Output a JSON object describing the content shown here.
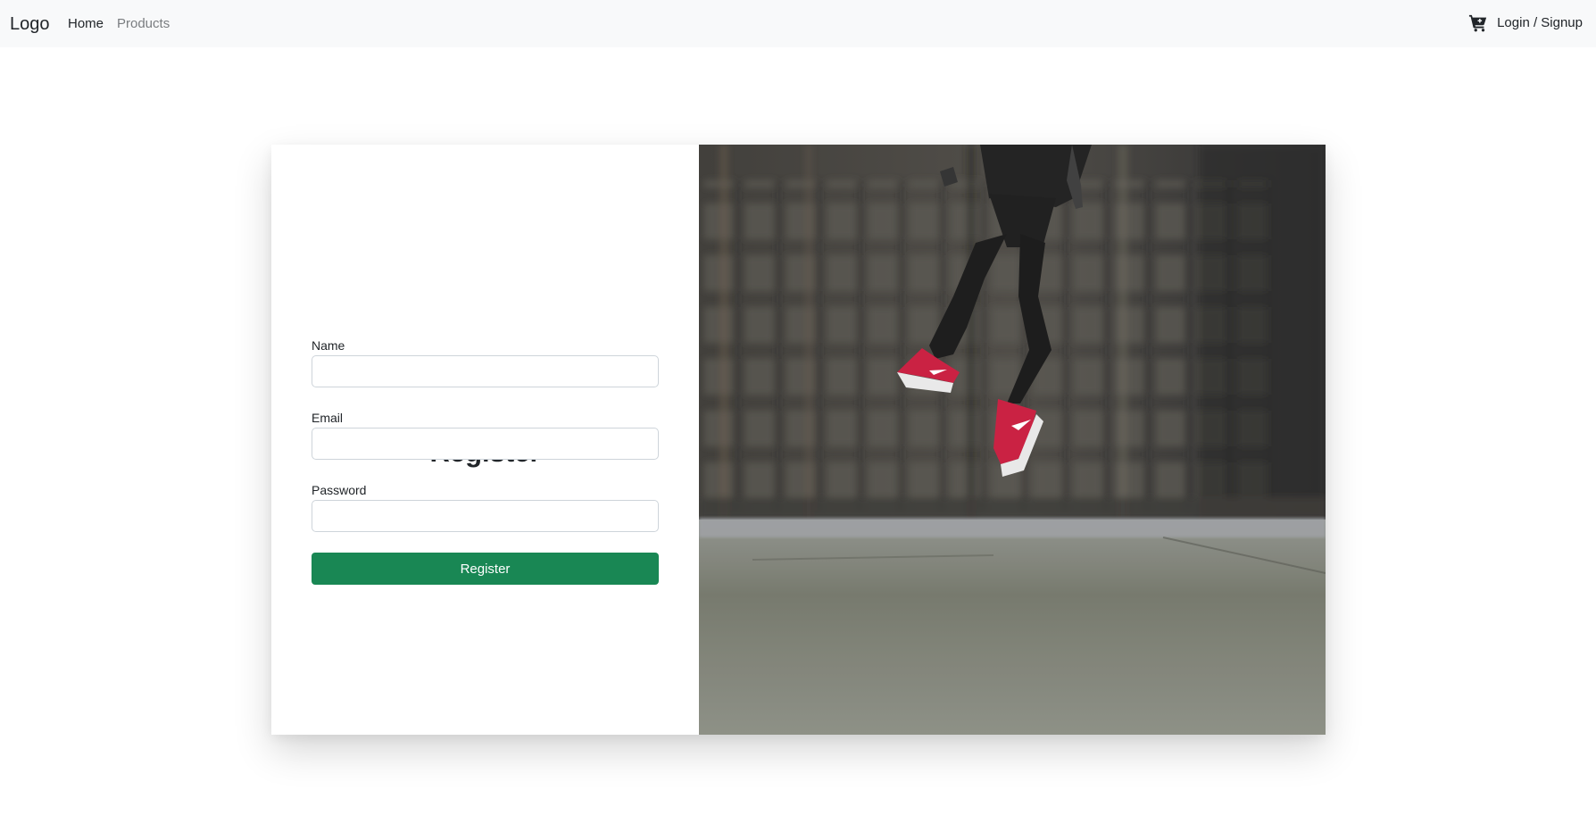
{
  "navbar": {
    "brand": "Logo",
    "links": [
      {
        "label": "Home"
      },
      {
        "label": "Products"
      }
    ],
    "cart_icon": "cart-icon",
    "login_label": "Login / Signup"
  },
  "register_form": {
    "title": "Register",
    "fields": {
      "name": {
        "label": "Name",
        "value": "",
        "placeholder": ""
      },
      "email": {
        "label": "Email",
        "value": "",
        "placeholder": ""
      },
      "password": {
        "label": "Password",
        "value": "",
        "placeholder": ""
      }
    },
    "submit_label": "Register"
  },
  "hero_image": {
    "subject": "jumping-person-red-sneakers-photo"
  },
  "colors": {
    "navbar_bg": "#f8f9fa",
    "primary_button": "#198754",
    "sneakers": "#c8193c"
  }
}
